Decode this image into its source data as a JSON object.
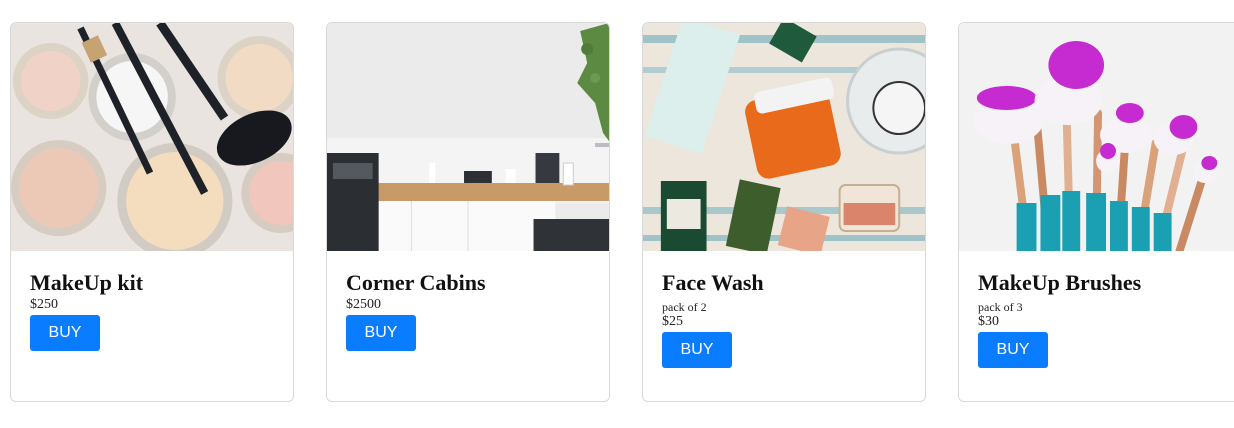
{
  "products": [
    {
      "title": "MakeUp kit",
      "note": "",
      "price": "$250",
      "button": "BUY",
      "image": "makeup-kit-photo"
    },
    {
      "title": "Corner Cabins",
      "note": "",
      "price": "$2500",
      "button": "BUY",
      "image": "kitchen-corner-photo"
    },
    {
      "title": "Face Wash",
      "note": "pack of 2",
      "price": "$25",
      "button": "BUY",
      "image": "skincare-products-photo"
    },
    {
      "title": "MakeUp Brushes",
      "note": "pack of 3",
      "price": "$30",
      "button": "BUY",
      "image": "makeup-brushes-photo"
    }
  ],
  "colors": {
    "button": "#0a7cff",
    "card_border": "#d9d9d9"
  }
}
